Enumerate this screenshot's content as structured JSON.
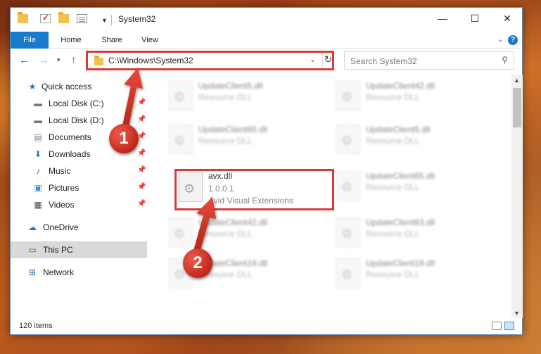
{
  "window": {
    "title": "System32",
    "minimize_glyph": "—",
    "maximize_glyph": "☐",
    "close_glyph": "✕"
  },
  "ribbon": {
    "tabs": [
      "File",
      "Home",
      "Share",
      "View"
    ],
    "help_glyph": "?"
  },
  "address": {
    "path": "C:\\Windows\\System32",
    "search_placeholder": "Search System32"
  },
  "nav_pane": {
    "items": [
      {
        "label": "Quick access",
        "icon": "star-icon"
      },
      {
        "label": "Local Disk (C:)",
        "icon": "drive-icon",
        "pinned": true
      },
      {
        "label": "Local Disk (D:)",
        "icon": "drive-icon",
        "pinned": true
      },
      {
        "label": "Documents",
        "icon": "documents-icon",
        "pinned": true
      },
      {
        "label": "Downloads",
        "icon": "downloads-icon",
        "pinned": true
      },
      {
        "label": "Music",
        "icon": "music-icon",
        "pinned": true
      },
      {
        "label": "Pictures",
        "icon": "pictures-icon",
        "pinned": true
      },
      {
        "label": "Videos",
        "icon": "videos-icon",
        "pinned": true
      },
      {
        "label": "OneDrive",
        "icon": "cloud-icon"
      },
      {
        "label": "This PC",
        "icon": "computer-icon",
        "selected": true
      },
      {
        "label": "Network",
        "icon": "network-icon"
      }
    ]
  },
  "files": [
    {
      "name": "UpdateClient5.dll",
      "type": "Resource DLL"
    },
    {
      "name": "UpdateClient42.dll",
      "type": "Resource DLL"
    },
    {
      "name": "UpdateClient65.dll",
      "type": "Resource DLL"
    },
    {
      "name": "UpdateClient5.dll",
      "type": "Resource DLL"
    },
    {
      "name": "avx.dll",
      "version": "1.0.0.1",
      "description": "Avid Visual Extensions",
      "highlighted": true
    },
    {
      "name": "UpdateClient65.dll",
      "type": "Resource DLL"
    },
    {
      "name": "UpdateClient42.dll",
      "type": "Resource DLL"
    },
    {
      "name": "UpdateClient63.dll",
      "type": "Resource DLL"
    },
    {
      "name": "UpdateClient19.dll",
      "type": "Resource DLL"
    },
    {
      "name": "UpdateClient19.dll",
      "type": "Resource DLL"
    }
  ],
  "status": {
    "item_count": "120 items"
  },
  "annotations": {
    "step1": "1",
    "step2": "2",
    "color": "#d93b3b"
  }
}
